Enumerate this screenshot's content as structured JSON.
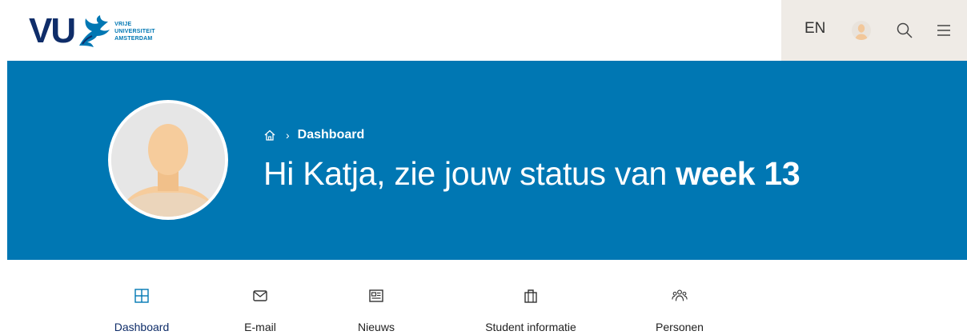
{
  "brand": {
    "short": "VU",
    "line1": "VRIJE",
    "line2": "UNIVERSITEIT",
    "line3": "AMSTERDAM",
    "color": "#0f2d69",
    "accent": "#0077b3"
  },
  "header": {
    "language": "EN",
    "icons": [
      "user-avatar",
      "search-icon",
      "menu-icon"
    ]
  },
  "hero": {
    "breadcrumb_current": "Dashboard",
    "greeting_prefix": "Hi Katja, zie jouw status van ",
    "greeting_bold": "week 13",
    "background": "#0077b3"
  },
  "nav": {
    "items": [
      {
        "label": "Dashboard",
        "icon": "grid-icon",
        "active": true
      },
      {
        "label": "E-mail",
        "icon": "mail-icon",
        "active": false
      },
      {
        "label": "Nieuws",
        "icon": "newspaper-icon",
        "active": false
      },
      {
        "label": "Student informatie",
        "icon": "briefcase-icon",
        "active": false
      },
      {
        "label": "Personen",
        "icon": "people-icon",
        "active": false
      }
    ]
  }
}
